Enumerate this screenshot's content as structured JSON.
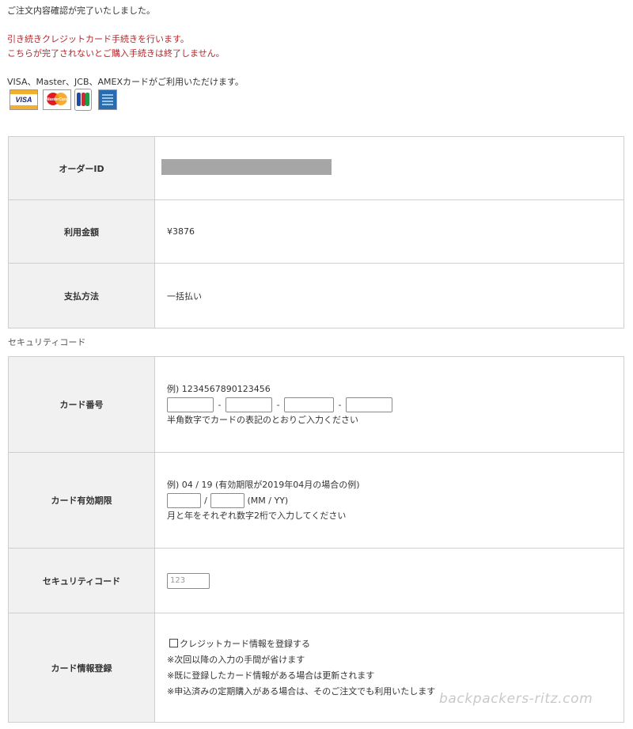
{
  "messages": {
    "complete": "ご注文内容確認が完了いたしました。",
    "continue_line1": "引き続きクレジットカード手続きを行います。",
    "continue_line2": "こちらが完了されないとご購入手続きは終了しません。",
    "cards_note": "VISA、Master、JCB、AMEXカードがご利用いただけます。"
  },
  "card_logos": [
    {
      "name": "visa-logo",
      "text": "VISA"
    },
    {
      "name": "mastercard-logo",
      "text": "MasterCard"
    },
    {
      "name": "jcb-logo",
      "text": ""
    },
    {
      "name": "amex-logo",
      "text": ""
    }
  ],
  "order": {
    "order_id_label": "オーダーID",
    "amount_label": "利用金額",
    "amount_value": "¥3876",
    "payment_label": "支払方法",
    "payment_value": "一括払い"
  },
  "section_label": "セキュリティコード",
  "card_form": {
    "number_label": "カード番号",
    "number_example": "例) 1234567890123456",
    "number_hint": "半角数字でカードの表記のとおりご入力ください",
    "dash": "-",
    "expiry_label": "カード有効期限",
    "expiry_example": "例) 04 / 19 (有効期限が2019年04月の場合の例)",
    "expiry_slash": "/",
    "expiry_format": "(MM / YY)",
    "expiry_hint": "月と年をそれぞれ数字2桁で入力してください",
    "security_label": "セキュリティコード",
    "security_placeholder": "123",
    "register_label": "カード情報登録",
    "register_checkbox": "クレジットカード情報を登録する",
    "register_note1": "※次回以降の入力の手間が省けます",
    "register_note2": "※既に登録したカード情報がある場合は更新されます",
    "register_note3": "※申込済みの定期購入がある場合は、そのご注文でも利用いたします"
  },
  "watermark": "backpackers-ritz.com"
}
